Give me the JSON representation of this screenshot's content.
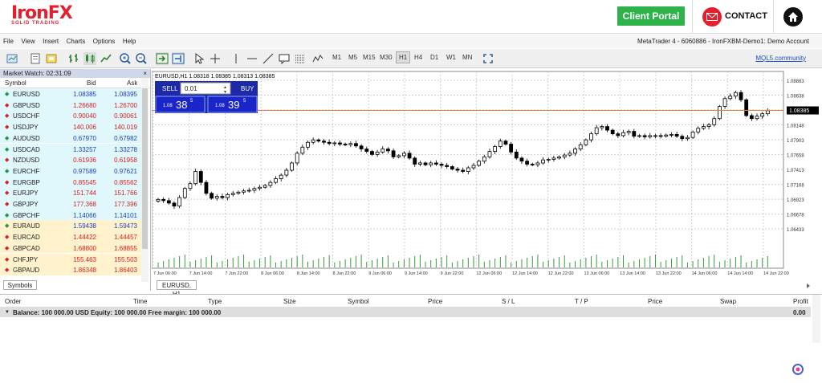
{
  "header": {
    "brand": "IronFX",
    "brand_tagline": "SOLID TRADING",
    "client_portal": "Client Portal",
    "contact": "CONTACT"
  },
  "menu": {
    "items": [
      "File",
      "View",
      "Insert",
      "Charts",
      "Options",
      "Help"
    ],
    "account": "MetaTrader 4 - 6060886 - IronFXBM-Demo1: Demo Account"
  },
  "toolbar": {
    "timeframes": [
      "M1",
      "M5",
      "M15",
      "M30",
      "H1",
      "H4",
      "D1",
      "W1",
      "MN"
    ],
    "active_timeframe": "H1",
    "mql": "MQL5.community"
  },
  "market_watch": {
    "title": "Market Watch: 02:31:09",
    "col_symbol": "Symbol",
    "col_bid": "Bid",
    "col_ask": "Ask",
    "tab": "Symbols",
    "rows": [
      {
        "symbol": "EURUSD",
        "bid": "1.08385",
        "ask": "1.08395",
        "dir": "up",
        "color": "blue",
        "bg": "cyan"
      },
      {
        "symbol": "GBPUSD",
        "bid": "1.26680",
        "ask": "1.26700",
        "dir": "down",
        "color": "red",
        "bg": "cyan"
      },
      {
        "symbol": "USDCHF",
        "bid": "0.90040",
        "ask": "0.90061",
        "dir": "down",
        "color": "red",
        "bg": "cyan"
      },
      {
        "symbol": "USDJPY",
        "bid": "140.006",
        "ask": "140.019",
        "dir": "down",
        "color": "red",
        "bg": "cyan"
      },
      {
        "symbol": "AUDUSD",
        "bid": "0.67970",
        "ask": "0.67982",
        "dir": "up",
        "color": "blue",
        "bg": "cyan"
      },
      {
        "symbol": "USDCAD",
        "bid": "1.33257",
        "ask": "1.33278",
        "dir": "up",
        "color": "blue",
        "bg": "cyan"
      },
      {
        "symbol": "NZDUSD",
        "bid": "0.61936",
        "ask": "0.61958",
        "dir": "down",
        "color": "red",
        "bg": "cyan"
      },
      {
        "symbol": "EURCHF",
        "bid": "0.97589",
        "ask": "0.97621",
        "dir": "up",
        "color": "blue",
        "bg": "cyan"
      },
      {
        "symbol": "EURGBP",
        "bid": "0.85545",
        "ask": "0.85562",
        "dir": "down",
        "color": "red",
        "bg": "cyan"
      },
      {
        "symbol": "EURJPY",
        "bid": "151.744",
        "ask": "151.766",
        "dir": "down",
        "color": "red",
        "bg": "cyan"
      },
      {
        "symbol": "GBPJPY",
        "bid": "177.368",
        "ask": "177.396",
        "dir": "down",
        "color": "red",
        "bg": "cyan"
      },
      {
        "symbol": "GBPCHF",
        "bid": "1.14066",
        "ask": "1.14101",
        "dir": "up",
        "color": "blue",
        "bg": "cyan"
      },
      {
        "symbol": "EURAUD",
        "bid": "1.59438",
        "ask": "1.59473",
        "dir": "up",
        "color": "blue",
        "bg": "yel"
      },
      {
        "symbol": "EURCAD",
        "bid": "1.44422",
        "ask": "1.44457",
        "dir": "down",
        "color": "red",
        "bg": "yel"
      },
      {
        "symbol": "GBPCAD",
        "bid": "1.68800",
        "ask": "1.68855",
        "dir": "down",
        "color": "red",
        "bg": "yel"
      },
      {
        "symbol": "CHFJPY",
        "bid": "155.463",
        "ask": "155.503",
        "dir": "down",
        "color": "red",
        "bg": "yel"
      },
      {
        "symbol": "GBPAUD",
        "bid": "1.86348",
        "ask": "1.86403",
        "dir": "down",
        "color": "red",
        "bg": "yel"
      }
    ]
  },
  "chart": {
    "info": "EURUSD,H1  1.08318 1.08385 1.08313 1.08385",
    "sell_label": "SELL",
    "buy_label": "BUY",
    "lot": "0.01",
    "sell_price_small": "1.08",
    "sell_price_big": "38",
    "sell_price_sup": "5",
    "buy_price_small": "1.08",
    "buy_price_big": "39",
    "buy_price_sup": "5",
    "tab": "EURUSD, H1",
    "current_price": "1.08385"
  },
  "chart_data": {
    "type": "candlestick",
    "symbol": "EURUSD",
    "timeframe": "H1",
    "y_ticks": [
      "1.08883",
      "1.08638",
      "1.08393",
      "1.08148",
      "1.07903",
      "1.07658",
      "1.07413",
      "1.07168",
      "1.06923",
      "1.06678",
      "1.06433"
    ],
    "ylim": [
      1.0629,
      1.09
    ],
    "x_ticks": [
      "7 Jun 06:00",
      "7 Jun 14:00",
      "7 Jun 22:00",
      "8 Jun 06:00",
      "8 Jun 14:00",
      "8 Jun 22:00",
      "9 Jun 06:00",
      "9 Jun 14:00",
      "9 Jun 22:00",
      "12 Jun 06:00",
      "12 Jun 14:00",
      "12 Jun 22:00",
      "13 Jun 06:00",
      "13 Jun 14:00",
      "13 Jun 22:00",
      "14 Jun 06:00",
      "14 Jun 14:00",
      "14 Jun 22:00"
    ],
    "close": [
      1.0692,
      1.069,
      1.0686,
      1.0681,
      1.0695,
      1.071,
      1.0718,
      1.0738,
      1.072,
      1.0702,
      1.0694,
      1.0697,
      1.0695,
      1.07,
      1.0702,
      1.0704,
      1.0706,
      1.0707,
      1.071,
      1.0712,
      1.0715,
      1.072,
      1.0726,
      1.0732,
      1.074,
      1.0752,
      1.0768,
      1.0778,
      1.0786,
      1.079,
      1.0788,
      1.0786,
      1.0784,
      1.0785,
      1.0783,
      1.0782,
      1.0784,
      1.078,
      1.0775,
      1.0771,
      1.0766,
      1.077,
      1.0775,
      1.0772,
      1.0762,
      1.0764,
      1.0768,
      1.076,
      1.075,
      1.0752,
      1.0749,
      1.0752,
      1.075,
      1.0748,
      1.0746,
      1.0742,
      1.074,
      1.0738,
      1.0744,
      1.0748,
      1.0755,
      1.0762,
      1.0771,
      1.0779,
      1.0788,
      1.0783,
      1.077,
      1.076,
      1.0755,
      1.075,
      1.0749,
      1.0752,
      1.0757,
      1.0758,
      1.076,
      1.0762,
      1.0765,
      1.0768,
      1.0775,
      1.0782,
      1.079,
      1.08,
      1.081,
      1.0812,
      1.0806,
      1.08,
      1.0797,
      1.0802,
      1.0804,
      1.0796,
      1.0797,
      1.0795,
      1.0797,
      1.0797,
      1.0796,
      1.0798,
      1.0799,
      1.0796,
      1.0792,
      1.0794,
      1.0803,
      1.0809,
      1.0812,
      1.0815,
      1.0825,
      1.0845,
      1.0858,
      1.0862,
      1.0868,
      1.0856,
      1.083,
      1.0825,
      1.0829,
      1.0833,
      1.0838
    ],
    "current": 1.08385
  },
  "orders": {
    "cols": [
      "Order",
      "Time",
      "Type",
      "Size",
      "Symbol",
      "Price",
      "S / L",
      "T / P",
      "Price",
      "Swap",
      "Profit"
    ],
    "balance": "Balance: 100 000.00 USD  Equity: 100 000.00  Free margin: 100 000.00",
    "profit": "0.00"
  }
}
